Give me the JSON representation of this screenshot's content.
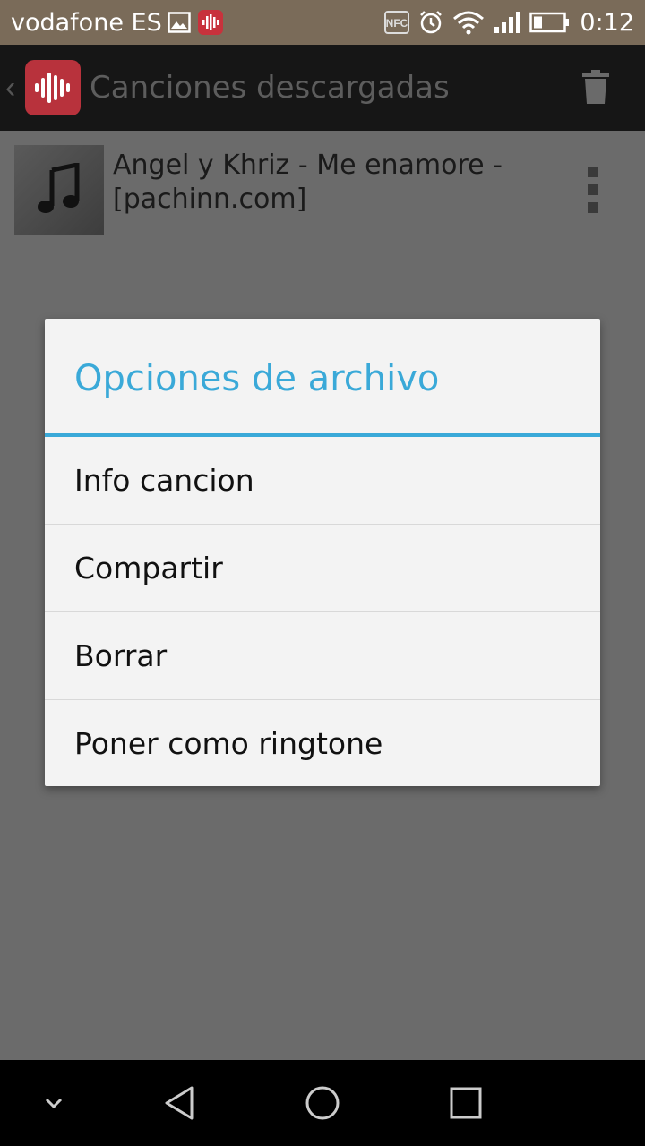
{
  "status_bar": {
    "carrier": "vodafone ES",
    "time": "0:12",
    "icons": [
      "image-icon",
      "app-notification-icon",
      "nfc-icon",
      "alarm-icon",
      "wifi-icon",
      "signal-icon",
      "battery-icon"
    ]
  },
  "app_bar": {
    "back": "‹",
    "title": "Canciones descargadas",
    "action_icon": "trash-icon"
  },
  "list": {
    "items": [
      {
        "title": "Angel y Khriz - Me enamore - [pachinn.com]",
        "thumb_icon": "music-note-icon"
      }
    ]
  },
  "dialog": {
    "title": "Opciones de archivo",
    "options": [
      "Info cancion",
      "Compartir",
      "Borrar",
      "Poner como ringtone"
    ]
  },
  "nav_bar": {
    "buttons": [
      "hide-keyboard-icon",
      "back-triangle-icon",
      "home-circle-icon",
      "recents-square-icon"
    ]
  },
  "colors": {
    "accent": "#3aa9d8",
    "app_bar_bg": "#161616",
    "scrim_bg": "#6b6b6b",
    "status_bar_bg": "#7a6b59"
  }
}
